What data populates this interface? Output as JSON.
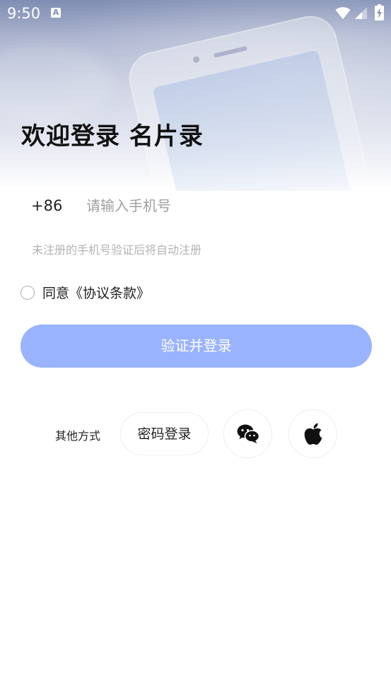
{
  "status_bar": {
    "time": "9:50",
    "notification_icon": "a-icon",
    "icons": [
      "wifi-icon",
      "signal-icon",
      "battery-icon"
    ]
  },
  "login": {
    "title": "欢迎登录 名片录",
    "country_code": "+86",
    "phone_placeholder": "请输入手机号",
    "phone_value": "",
    "hint": "未注册的手机号验证后将自动注册",
    "agree_label": "同意《协议条款》",
    "agree_checked": false,
    "submit_label": "验证并登录"
  },
  "other_methods": {
    "label": "其他方式",
    "password_label": "密码登录",
    "icons": [
      "wechat-icon",
      "apple-icon"
    ]
  },
  "colors": {
    "primary_button": "#99b3ff",
    "hero_top": "#7f8db3",
    "hint_text": "#b3b3b3"
  }
}
